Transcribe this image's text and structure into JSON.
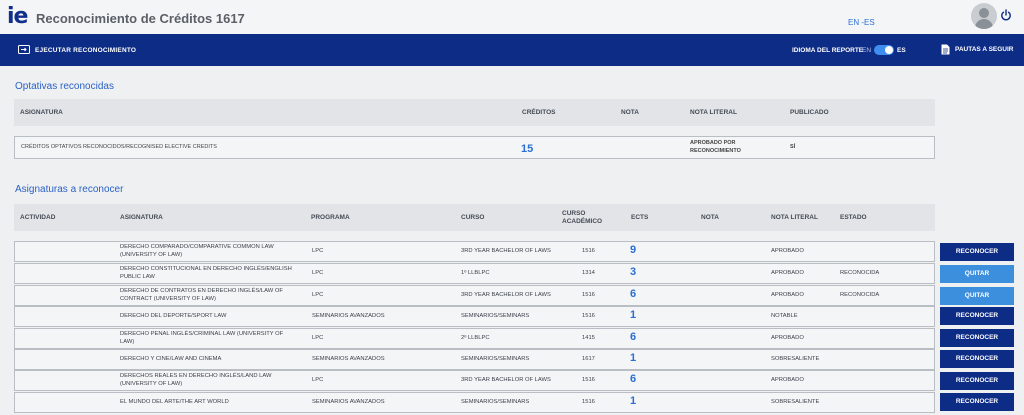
{
  "header": {
    "logo": "ie",
    "title": "Reconocimiento de Créditos 1617",
    "lang_en": "EN",
    "lang_sep": "-",
    "lang_es": "ES"
  },
  "navbar": {
    "action_label": "EJECUTAR RECONOCIMIENTO",
    "report_lang_label": "IDIOMA DEL REPORTE",
    "toggle_off": "EN",
    "toggle_on": "ES",
    "guide_label": "PAUTAS A SEGUIR"
  },
  "optativas": {
    "title": "Optativas reconocidas",
    "columns": [
      "ASIGNATURA",
      "CRÉDITOS",
      "NOTA",
      "NOTA LITERAL",
      "PUBLICADO"
    ],
    "row": {
      "asignatura": "CRÉDITOS OPTATIVOS RECONOCIDOS/RECOGNISED ELECTIVE CREDITS",
      "creditos": "15",
      "nota": "",
      "nota_literal_1": "APROBADO POR",
      "nota_literal_2": "RECONOCIMIENTO",
      "publicado": "SÍ"
    }
  },
  "asignaturas": {
    "title": "Asignaturas a reconocer",
    "columns": {
      "actividad": "ACTIVIDAD",
      "asignatura": "ASIGNATURA",
      "programa": "PROGRAMA",
      "curso": "CURSO",
      "curso_academico_1": "CURSO",
      "curso_academico_2": "ACADÉMICO",
      "ects": "ECTS",
      "nota": "NOTA",
      "nota_literal": "NOTA LITERAL",
      "estado": "ESTADO"
    },
    "rows": [
      {
        "a1": "DERECHO COMPARADO/COMPARATIVE COMMON LAW",
        "a2": "(UNIVERSITY OF LAW)",
        "programa": "LPC",
        "curso": "3RD YEAR BACHELOR OF LAWS",
        "academico": "1516",
        "ects": "9",
        "nota_literal": "APROBADO",
        "estado": "",
        "action": "RECONOCER"
      },
      {
        "a1": "DERECHO CONSTITUCIONAL EN DERECHO INGLÉS/ENGLISH",
        "a2": "PUBLIC LAW",
        "programa": "LPC",
        "curso": "1º LLBLPC",
        "academico": "1314",
        "ects": "3",
        "nota_literal": "APROBADO",
        "estado": "RECONOCIDA",
        "action": "QUITAR"
      },
      {
        "a1": "DERECHO DE CONTRATOS EN DERECHO INGLÉS/LAW OF",
        "a2": "CONTRACT (UNIVERSITY OF LAW)",
        "programa": "LPC",
        "curso": "3RD YEAR BACHELOR OF LAWS",
        "academico": "1516",
        "ects": "6",
        "nota_literal": "APROBADO",
        "estado": "RECONOCIDA",
        "action": "QUITAR"
      },
      {
        "a1": "DERECHO DEL DEPORTE/SPORT LAW",
        "a2": "",
        "programa": "SEMINARIOS AVANZADOS",
        "curso": "SEMINARIOS/SEMINARS",
        "academico": "1516",
        "ects": "1",
        "nota_literal": "NOTABLE",
        "estado": "",
        "action": "RECONOCER"
      },
      {
        "a1": "DERECHO PENAL INGLÉS/CRIMINAL LAW (UNIVERSITY OF",
        "a2": "LAW)",
        "programa": "LPC",
        "curso": "2º LLBLPC",
        "academico": "1415",
        "ects": "6",
        "nota_literal": "APROBADO",
        "estado": "",
        "action": "RECONOCER"
      },
      {
        "a1": "DERECHO Y CINE/LAW AND CINEMA",
        "a2": "",
        "programa": "SEMINARIOS AVANZADOS",
        "curso": "SEMINARIOS/SEMINARS",
        "academico": "1617",
        "ects": "1",
        "nota_literal": "SOBRESALIENTE",
        "estado": "",
        "action": "RECONOCER"
      },
      {
        "a1": "DERECHOS REALES EN DERECHO INGLÉS/LAND LAW",
        "a2": "(UNIVERSITY OF LAW)",
        "programa": "LPC",
        "curso": "3RD YEAR BACHELOR OF LAWS",
        "academico": "1516",
        "ects": "6",
        "nota_literal": "APROBADO",
        "estado": "",
        "action": "RECONOCER"
      },
      {
        "a1": "EL MUNDO DEL ARTE/THE ART WORLD",
        "a2": "",
        "programa": "SEMINARIOS AVANZADOS",
        "curso": "SEMINARIOS/SEMINARS",
        "academico": "1516",
        "ects": "1",
        "nota_literal": "SOBRESALIENTE",
        "estado": "",
        "action": "RECONOCER"
      }
    ]
  },
  "colors": {
    "navy": "#0d2c86",
    "accent_blue": "#2a6fd1",
    "quitar_blue": "#3c8fdc"
  }
}
